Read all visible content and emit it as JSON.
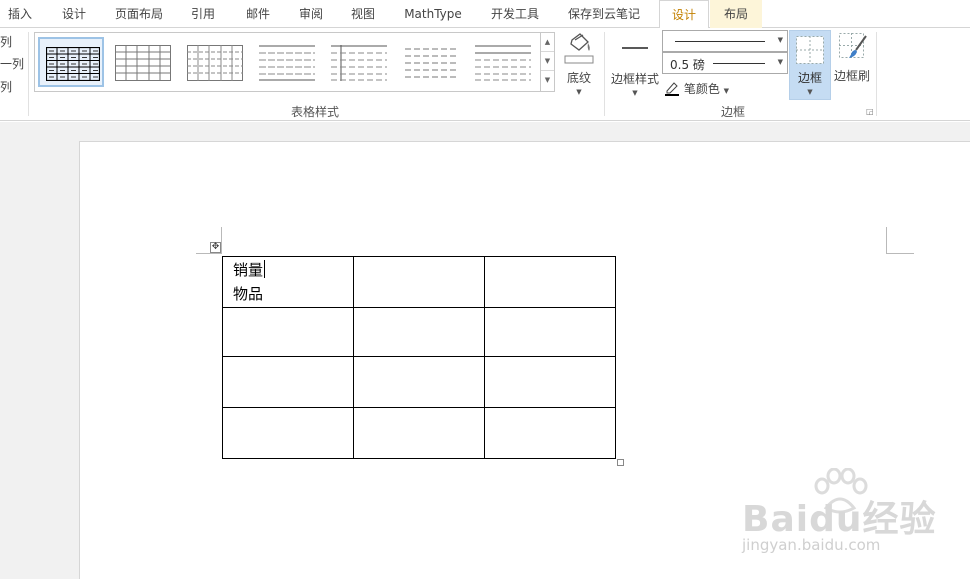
{
  "tabs": [
    {
      "label": "插入"
    },
    {
      "label": "设计"
    },
    {
      "label": "页面布局"
    },
    {
      "label": "引用"
    },
    {
      "label": "邮件"
    },
    {
      "label": "审阅"
    },
    {
      "label": "视图"
    },
    {
      "label": "MathType"
    },
    {
      "label": "开发工具"
    },
    {
      "label": "保存到云笔记"
    },
    {
      "label": "设计",
      "state": "active",
      "contextual": true
    },
    {
      "label": "布局",
      "contextual": true
    }
  ],
  "ribbon": {
    "left_fragments": [
      "列",
      "一列",
      "列"
    ],
    "table_styles": {
      "group_label": "表格样式",
      "shading_label": "底纹",
      "gallery_count": 7,
      "selected_index": 0
    },
    "borders": {
      "group_label": "边框",
      "border_styles_label": "边框样式",
      "line_weight": "0.5 磅",
      "pen_color_label": "笔颜色",
      "borders_label": "边框",
      "border_painter_label": "边框刷"
    },
    "colors": {
      "accent_tab_text": "#c28000",
      "contextual_tab_bg": "#fdf5d9",
      "borders_button_bg": "#c5dcf3"
    },
    "icons": {
      "shading": "paint-bucket-icon",
      "border_styles": "line-icon",
      "pen_color": "pen-icon",
      "borders": "grid-border-icon",
      "border_painter": "brush-icon",
      "table_move": "four-arrow-move-icon"
    }
  },
  "document": {
    "table": {
      "rows": 4,
      "cols": 3,
      "cells": [
        [
          "销量\n物品",
          "",
          ""
        ],
        [
          "",
          "",
          ""
        ],
        [
          "",
          "",
          ""
        ],
        [
          "",
          "",
          ""
        ]
      ],
      "cell_1_line1": "销量",
      "cell_1_line2": "物品"
    }
  },
  "watermark": {
    "brand": "Baidu经验",
    "url": "jingyan.baidu.com"
  }
}
